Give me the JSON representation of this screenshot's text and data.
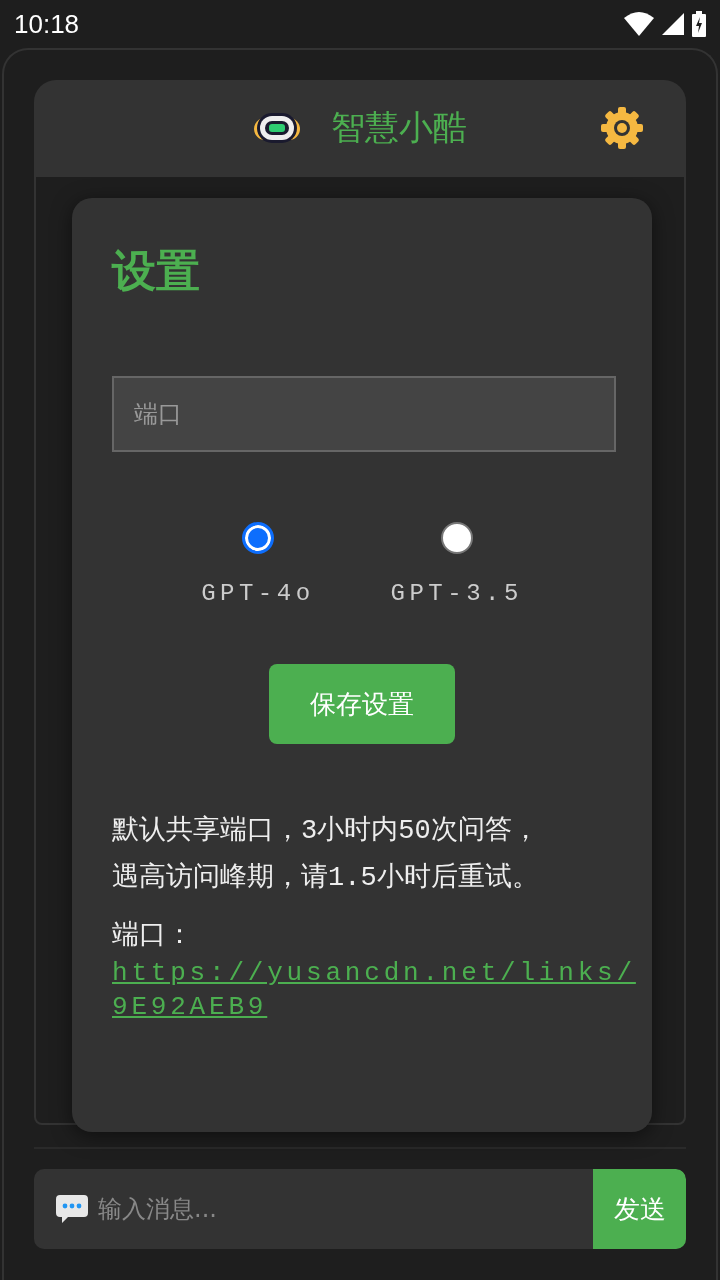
{
  "status_bar": {
    "time": "10:18"
  },
  "header": {
    "title": "智慧小酷"
  },
  "settings_dialog": {
    "title": "设置",
    "port_field": {
      "placeholder": "端口"
    },
    "models": [
      {
        "label": "GPT-4o",
        "selected": true
      },
      {
        "label": "GPT-3.5",
        "selected": false
      }
    ],
    "save_button": "保存设置",
    "notice": "默认共享端口，3小时内50次问答，遇高访问峰期，请1.5小时后重试。",
    "port_label": "端口：",
    "port_link": "https://yusancdn.net/links/9E92AEB9"
  },
  "message_bar": {
    "placeholder": "输入消息...",
    "send_button": "发送"
  }
}
